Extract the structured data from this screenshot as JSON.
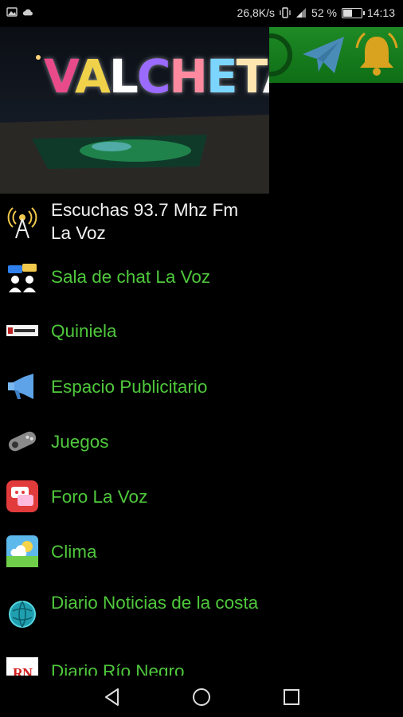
{
  "status_bar": {
    "network_speed": "26,8K/s",
    "battery_percent": "52 %",
    "battery_level": 0.52,
    "time": "14:13"
  },
  "header": {
    "sign_text": "VALCHETA"
  },
  "menu": {
    "items": [
      {
        "label": "Escuchas 93.7 Mhz Fm La Voz",
        "icon": "radio-tower-icon"
      },
      {
        "label": "Sala de chat La Voz",
        "icon": "chat-users-icon"
      },
      {
        "label": "Quiniela",
        "icon": "lottery-ticket-icon"
      },
      {
        "label": "Espacio Publicitario",
        "icon": "megaphone-icon"
      },
      {
        "label": "Juegos",
        "icon": "gamepad-icon"
      },
      {
        "label": "Foro La Voz",
        "icon": "forum-icon"
      },
      {
        "label": "Clima",
        "icon": "weather-icon"
      },
      {
        "label": "Diario Noticias de la costa",
        "icon": "globe-icon"
      },
      {
        "label": "Diario Río Negro",
        "icon": "rn-logo-icon"
      }
    ]
  },
  "rn_logo_text": "RN",
  "colors": {
    "menu_text": "#4fc83c",
    "toolbar": "#1a8a22"
  }
}
